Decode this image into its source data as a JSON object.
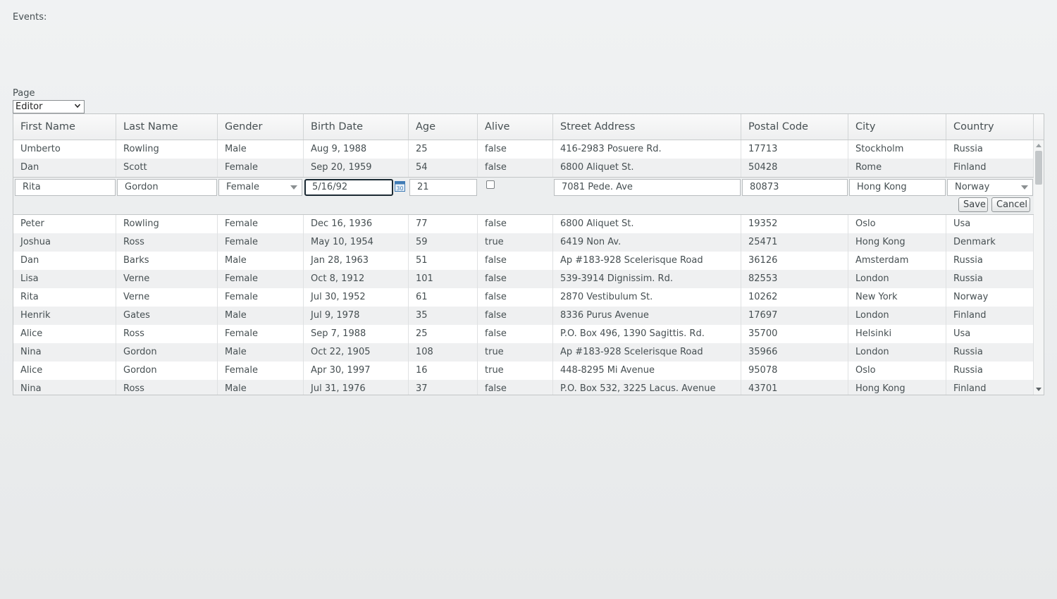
{
  "events_label": "Events:",
  "page": {
    "label": "Page",
    "selected": "Editor"
  },
  "columns": [
    "First Name",
    "Last Name",
    "Gender",
    "Birth Date",
    "Age",
    "Alive",
    "Street Address",
    "Postal Code",
    "City",
    "Country"
  ],
  "rows_before": [
    [
      "Umberto",
      "Rowling",
      "Male",
      "Aug 9, 1988",
      "25",
      "false",
      "416-2983 Posuere Rd.",
      "17713",
      "Stockholm",
      "Russia"
    ],
    [
      "Dan",
      "Scott",
      "Female",
      "Sep 20, 1959",
      "54",
      "false",
      "6800 Aliquet St.",
      "50428",
      "Rome",
      "Finland"
    ]
  ],
  "editor": {
    "first_name": "Rita",
    "last_name": "Gordon",
    "gender": "Female",
    "birth_date": "5/16/92",
    "age": "21",
    "alive": false,
    "street": "7081 Pede. Ave",
    "postal": "80873",
    "city": "Hong Kong",
    "country": "Norway",
    "save_label": "Save",
    "cancel_label": "Cancel"
  },
  "rows_after": [
    [
      "Peter",
      "Rowling",
      "Female",
      "Dec 16, 1936",
      "77",
      "false",
      "6800 Aliquet St.",
      "19352",
      "Oslo",
      "Usa"
    ],
    [
      "Joshua",
      "Ross",
      "Female",
      "May 10, 1954",
      "59",
      "true",
      "6419 Non Av.",
      "25471",
      "Hong Kong",
      "Denmark"
    ],
    [
      "Dan",
      "Barks",
      "Male",
      "Jan 28, 1963",
      "51",
      "false",
      "Ap #183-928 Scelerisque Road",
      "36126",
      "Amsterdam",
      "Russia"
    ],
    [
      "Lisa",
      "Verne",
      "Female",
      "Oct 8, 1912",
      "101",
      "false",
      "539-3914 Dignissim. Rd.",
      "82553",
      "London",
      "Russia"
    ],
    [
      "Rita",
      "Verne",
      "Female",
      "Jul 30, 1952",
      "61",
      "false",
      "2870 Vestibulum St.",
      "10262",
      "New York",
      "Norway"
    ],
    [
      "Henrik",
      "Gates",
      "Male",
      "Jul 9, 1978",
      "35",
      "false",
      "8336 Purus Avenue",
      "17697",
      "London",
      "Finland"
    ],
    [
      "Alice",
      "Ross",
      "Female",
      "Sep 7, 1988",
      "25",
      "false",
      "P.O. Box 496, 1390 Sagittis. Rd.",
      "35700",
      "Helsinki",
      "Usa"
    ],
    [
      "Nina",
      "Gordon",
      "Male",
      "Oct 22, 1905",
      "108",
      "true",
      "Ap #183-928 Scelerisque Road",
      "35966",
      "London",
      "Russia"
    ],
    [
      "Alice",
      "Gordon",
      "Female",
      "Apr 30, 1997",
      "16",
      "true",
      "448-8295 Mi Avenue",
      "95078",
      "Oslo",
      "Russia"
    ],
    [
      "Nina",
      "Ross",
      "Male",
      "Jul 31, 1976",
      "37",
      "false",
      "P.O. Box 532, 3225 Lacus. Avenue",
      "43701",
      "Hong Kong",
      "Finland"
    ]
  ]
}
